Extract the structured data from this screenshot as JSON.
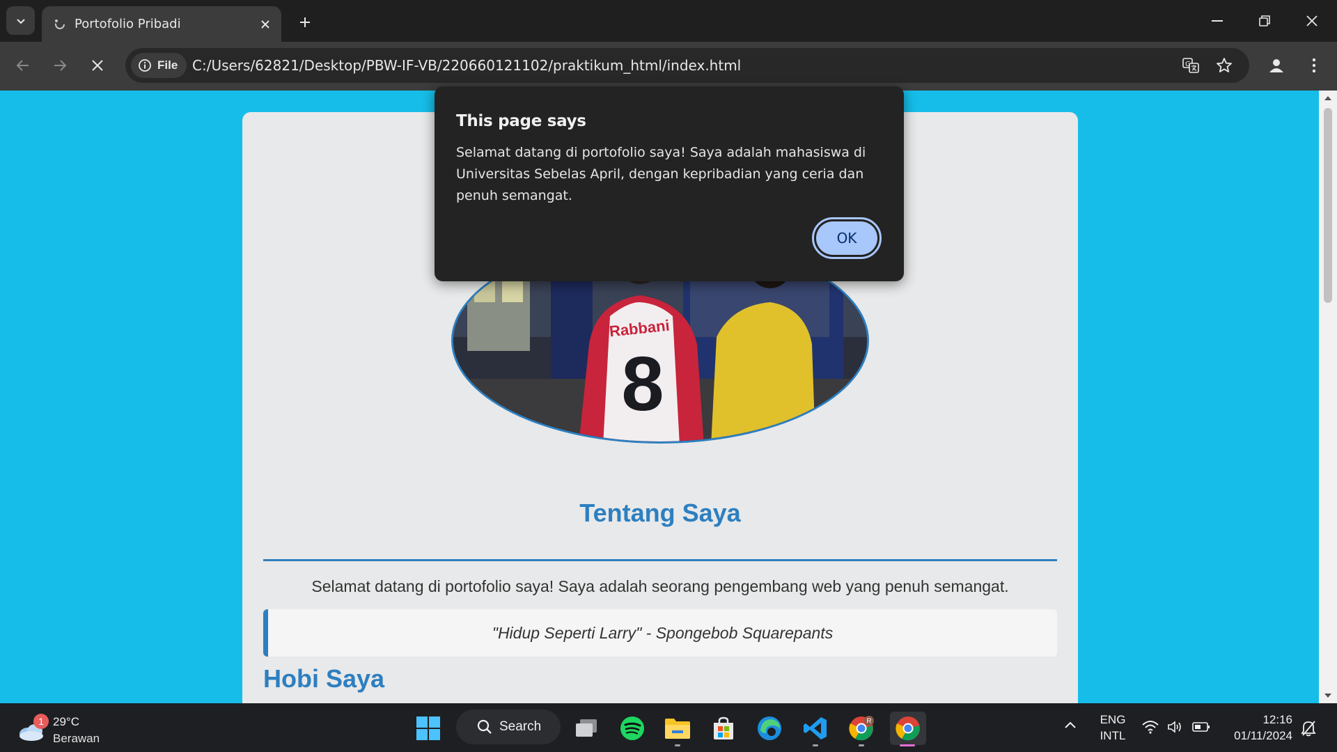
{
  "browser": {
    "tab_title": "Portofolio Pribadi",
    "file_chip": "File",
    "url": "C:/Users/62821/Desktop/PBW-IF-VB/220660121102/praktikum_html/index.html"
  },
  "page": {
    "about_title": "Tentang Saya",
    "about_text": "Selamat datang di portofolio saya! Saya adalah seorang pengembang web yang penuh semangat.",
    "quote": "\"Hidup Seperti Larry\" - Spongebob Squarepants",
    "hobby_title": "Hobi Saya",
    "photo_jersey_name": "Rabbani",
    "photo_jersey_number": "8"
  },
  "dialog": {
    "title": "This page says",
    "message": "Selamat datang di portofolio saya! Saya adalah mahasiswa di Universitas Sebelas April, dengan kepribadian yang ceria dan penuh semangat.",
    "ok_label": "OK"
  },
  "taskbar": {
    "weather_badge": "1",
    "temperature": "29°C",
    "condition": "Berawan",
    "search_label": "Search",
    "lang_line1": "ENG",
    "lang_line2": "INTL",
    "time": "12:16",
    "date": "01/11/2024",
    "chrome_profile_badge": "R"
  },
  "colors": {
    "page_background": "#16bde8",
    "accent": "#2d7fc0",
    "dialog_button": "#a8c7fa"
  }
}
